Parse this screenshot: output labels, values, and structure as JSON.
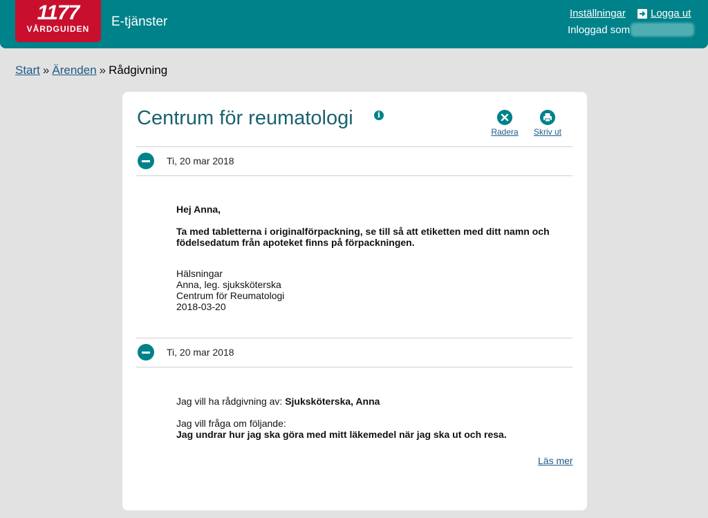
{
  "header": {
    "logo_number": "1177",
    "logo_text": "VÅRDGUIDEN",
    "app_title": "E-tjänster",
    "settings_label": "Inställningar",
    "logout_label": "Logga ut",
    "logged_in_label": "Inloggad som",
    "colors": {
      "header_bg": "#00828a",
      "logo_bg": "#c8102e"
    }
  },
  "breadcrumb": {
    "items": [
      "Start",
      "Ärenden",
      "Rådgivning"
    ],
    "separator": "»"
  },
  "card": {
    "title": "Centrum för reumatologi",
    "info_icon": "info-icon",
    "actions": {
      "delete_label": "Radera",
      "print_label": "Skriv ut"
    },
    "messages": [
      {
        "date": "Ti, 20 mar 2018",
        "greeting": "Hej Anna,",
        "body_line1": "Ta med tabletterna i originalförpackning, se till så att etiketten med ditt namn och",
        "body_line2": "födelsedatum från apoteket finns på förpackningen.",
        "signature": [
          "Hälsningar",
          "Anna, leg. sjuksköterska",
          "Centrum för Reumatologi",
          "2018-03-20"
        ]
      },
      {
        "date": "Ti, 20 mar 2018",
        "advice_prefix": "Jag vill ha rådgivning av: ",
        "advice_value": "Sjuksköterska, Anna",
        "question_label": "Jag vill fråga om följande:",
        "question_text": "Jag undrar hur jag ska göra med mitt läkemedel när jag ska ut och resa."
      }
    ],
    "read_more_label": "Läs mer"
  }
}
